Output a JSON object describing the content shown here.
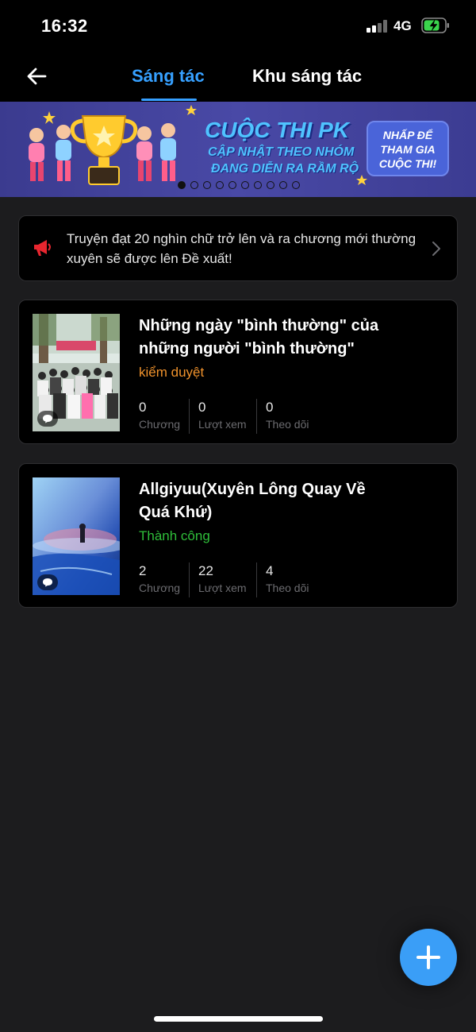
{
  "status_bar": {
    "time": "16:32",
    "network": "4G"
  },
  "nav": {
    "tabs": [
      {
        "label": "Sáng tác",
        "active": true
      },
      {
        "label": "Khu sáng tác",
        "active": false
      }
    ]
  },
  "banner": {
    "title": "CUỘC THI PK",
    "line1": "CẬP NHẬT THEO NHÓM",
    "line2": "ĐANG DIỄN RA RẦM RỘ",
    "cta": "NHẤP ĐỂ THAM GIA CUỘC THI!",
    "page_count": 10,
    "active_page": 1
  },
  "notice": {
    "text": "Truyện đạt 20 nghìn chữ trở lên và ra chương mới thường xuyên sẽ được lên Đề xuất!"
  },
  "stories": [
    {
      "title": "Những ngày \"bình thường\" của những người \"bình thường\"",
      "status": "kiểm duyệt",
      "status_color": "#f0922c",
      "stats": [
        {
          "value": "0",
          "label": "Chương"
        },
        {
          "value": "0",
          "label": "Lượt xem"
        },
        {
          "value": "0",
          "label": "Theo dõi"
        }
      ]
    },
    {
      "title": "Allgiyuu(Xuyên Lông Quay Về Quá Khứ)",
      "status": "Thành công",
      "status_color": "#2fbf3a",
      "stats": [
        {
          "value": "2",
          "label": "Chương"
        },
        {
          "value": "22",
          "label": "Lượt xem"
        },
        {
          "value": "4",
          "label": "Theo dõi"
        }
      ]
    }
  ],
  "colors": {
    "accent": "#36a0ff",
    "background": "#1c1c1e",
    "card": "#000000"
  }
}
